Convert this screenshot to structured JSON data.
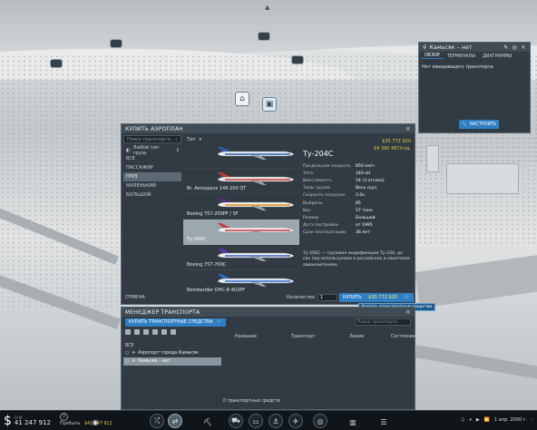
{
  "buy_window": {
    "title": "КУПИТЬ АЭРОПЛАН",
    "close": "×",
    "search_placeholder": "Поиск транспорта...",
    "filter_label": "Любой тип груза",
    "sort_label": "Тип",
    "categories": [
      {
        "label": "ВСЕ",
        "active": false
      },
      {
        "label": "ПАССАЖИР",
        "active": false
      },
      {
        "label": "ГРУЗ",
        "active": true
      },
      {
        "label": "МАЛЕНЬКИЙ",
        "active": false
      },
      {
        "label": "БОЛЬШОЙ",
        "active": false
      }
    ],
    "planes": [
      {
        "name": "",
        "selected": false,
        "fuselage": "#e9ecee",
        "stripe": "#2f5fb0",
        "tail": "#2f5fb0"
      },
      {
        "name": "Br. Aerospace 146-200 QT",
        "selected": false,
        "fuselage": "#e7e9ea",
        "stripe": "#c73a2e",
        "tail": "#c73a2e"
      },
      {
        "name": "Boeing 757-200PF / SF",
        "selected": false,
        "fuselage": "#f2f2f2",
        "stripe": "#e08a1e",
        "tail": "#5a2c86"
      },
      {
        "name": "Ту-204С",
        "selected": true,
        "fuselage": "#f0f1f2",
        "stripe": "#c8393f",
        "tail": "#c8393f"
      },
      {
        "name": "Boeing 757-700С",
        "selected": false,
        "fuselage": "#eef0f2",
        "stripe": "#3a5fc0",
        "tail": "#5a3ab0"
      },
      {
        "name": "Bombardier DHC-8-402PF",
        "selected": false,
        "fuselage": "#e9ecee",
        "stripe": "#2d6bd1",
        "tail": "#2d6bd1"
      }
    ],
    "detail": {
      "price": "$35 772 920",
      "running_cost": "$4 395 487/год.",
      "title": "Ту-204С",
      "rows": [
        {
          "k": "Предельная скорость",
          "v": "850 км/ч"
        },
        {
          "k": "Тяга",
          "v": "340 кН"
        },
        {
          "k": "Вместимость",
          "v": "54  (3 отсека)"
        },
        {
          "k": "Типы грузов",
          "v": "Весь груз"
        },
        {
          "k": "Скорость погрузки",
          "v": "2.0х"
        },
        {
          "k": "Выбросы",
          "v": "85"
        },
        {
          "k": "Вес",
          "v": "57 тонн"
        },
        {
          "k": "Размер",
          "v": "Большой"
        },
        {
          "k": "Дата постройки",
          "v": "от 1995"
        },
        {
          "k": "Срок эксплуатации",
          "v": "36 лет"
        }
      ],
      "description": "Ту-204С — грузовая модификация Ту-204, до сих пор используемая в российских и азиатских авиакомпаниях."
    },
    "cancel_label": "ОТМЕНА",
    "quantity_label": "Количество",
    "quantity_value": "1",
    "buy_label": "КУПИТЬ",
    "buy_cost": "$35 772 920",
    "tooltip": "Купить транспортные средства"
  },
  "info_window": {
    "title": "Камьсяк – нет",
    "tabs": [
      "ОБЗОР",
      "ТЕРМИНАЛЫ",
      "ДИАГРАММЫ"
    ],
    "message": "Нет ожидающего транспорта",
    "configure_label": "НАСТРОИТЬ"
  },
  "manager": {
    "title": "МЕНЕДЖЕР ТРАНСПОРТА",
    "buy_label": "КУПИТЬ ТРАНСПОРТНЫЕ СРЕДСТВА",
    "search_placeholder": "Поиск транспорта...",
    "columns": [
      "Название",
      "Транспорт",
      "Линии",
      "Состояние"
    ],
    "group_label": "ВСЕ",
    "items": [
      {
        "label": "Аэропорт города Камысяк",
        "selected": false
      },
      {
        "label": "Камьсяк – нет",
        "selected": true
      }
    ],
    "empty_text": "0 транспортных средств"
  },
  "bottom_bar": {
    "money": "41 247 912",
    "money_label": "ОЧК",
    "income_label": "Прибыль",
    "income_value": "$41 247 912",
    "help": "?",
    "date": "1 апр. 2000 г."
  },
  "colors": {
    "accent": "#2f7fc4",
    "panel": "#2c363e",
    "money": "#e6c54a"
  }
}
